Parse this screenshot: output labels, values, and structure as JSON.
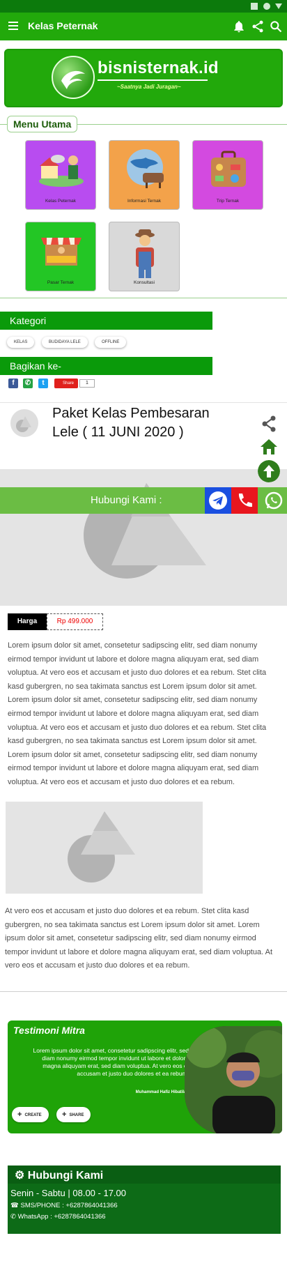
{
  "colors": {
    "brand_green": "#22a90b",
    "dark_green": "#0a5e13",
    "price_red": "#e00000"
  },
  "appbar": {
    "title": "Kelas Peternak",
    "icons": [
      "menu-icon",
      "bell-icon",
      "share-icon",
      "search-icon"
    ]
  },
  "banner": {
    "brand": "bisnisternak.id",
    "tagline": "~Saatnya Jadi Juragan~"
  },
  "menu": {
    "heading": "Menu Utama",
    "items": [
      {
        "label": "Kelas Peternak",
        "color": "#b84cf0"
      },
      {
        "label": "Informasi Ternak",
        "color": "#f3a24a"
      },
      {
        "label": "Trip Ternak",
        "color": "#d34ae0"
      },
      {
        "label": "Pasar Ternak",
        "color": "#23c625"
      },
      {
        "label": "Konsultasi",
        "color": "#d9d9d9"
      }
    ]
  },
  "category": {
    "heading": "Kategori",
    "chips": [
      "KELAS",
      "BUDIDAYA LELE",
      "OFFLINE"
    ]
  },
  "share": {
    "heading": "Bagikan ke-",
    "share_label": "Share",
    "count": "1"
  },
  "post": {
    "title": "Paket Kelas Pembesaran Lele ( 11 JUNI 2020 )"
  },
  "contact_bar": {
    "label": "Hubungi Kami :"
  },
  "price": {
    "label": "Harga",
    "value": "Rp 499.000"
  },
  "content": {
    "paragraph1": "Lorem ipsum dolor sit amet, consetetur sadipscing elitr, sed diam nonumy eirmod tempor invidunt ut labore et dolore magna aliquyam erat, sed diam voluptua. At vero eos et accusam et justo duo dolores et ea rebum. Stet clita kasd gubergren, no sea takimata sanctus est Lorem ipsum dolor sit amet. Lorem ipsum dolor sit amet, consetetur sadipscing elitr, sed diam nonumy eirmod tempor invidunt ut labore et dolore magna aliquyam erat, sed diam voluptua. At vero eos et accusam et justo duo dolores et ea rebum. Stet clita kasd gubergren, no sea takimata sanctus est Lorem ipsum dolor sit amet. Lorem ipsum dolor sit amet, consetetur sadipscing elitr, sed diam nonumy eirmod tempor invidunt ut labore et dolore magna aliquyam erat, sed diam voluptua. At vero eos et accusam et justo duo dolores et ea rebum.",
    "paragraph2": "At vero eos et accusam et justo duo dolores et ea rebum. Stet clita kasd gubergren, no sea takimata sanctus est Lorem ipsum dolor sit amet. Lorem ipsum dolor sit amet, consetetur sadipscing elitr, sed diam nonumy eirmod tempor invidunt ut labore et dolore magna aliquyam erat, sed diam voluptua. At vero eos et accusam et justo duo dolores et ea rebum."
  },
  "testimonial": {
    "title": "Testimoni Mitra",
    "quote": "Lorem ipsum dolor sit amet, consetetur sadipscing elitr, sed diam nonumy eirmod tempor invidunt ut labore et dolore magna aliquyam erat, sed diam voluptua. At vero eos et accusam et justo duo dolores et ea rebum.",
    "author": "Muhammad Hafiz Hibatilah",
    "create_label": "CREATE",
    "share_label": "SHARE"
  },
  "contact": {
    "heading": "Hubungi Kami",
    "hours": "Senin - Sabtu | 08.00 - 17.00",
    "phone": "SMS/PHONE : +6287864041366",
    "whatsapp": "WhatsApp : +6287864041366"
  }
}
